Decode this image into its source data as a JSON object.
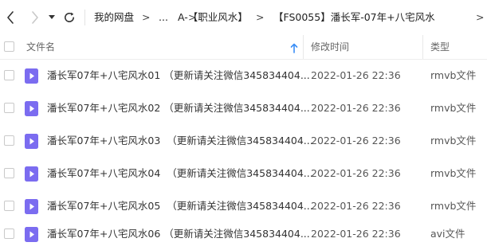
{
  "nav": {
    "back_icon": "chevron-left-icon",
    "forward_icon": "chevron-right-icon",
    "history_icon": "caret-down-icon",
    "refresh_icon": "refresh-icon",
    "breadcrumbs": [
      "我的网盘",
      "...",
      "A-【职业风水】",
      "【FS0055】潘长军-07年+八宅风水"
    ],
    "separator": ">"
  },
  "table": {
    "headers": {
      "name": "文件名",
      "modified": "修改时间",
      "type": "类型"
    },
    "sort_icon": "arrow-up-icon",
    "file_icon": "video-file-icon",
    "accent_color": "#7b6cf0",
    "rows": [
      {
        "name": "潘长军07年+八宅风水01 （更新请关注微信345834404...",
        "modified": "2022-01-26 22:36",
        "type": "rmvb文件"
      },
      {
        "name": "潘长军07年+八宅风水02 （更新请关注微信345834404...",
        "modified": "2022-01-26 22:36",
        "type": "rmvb文件"
      },
      {
        "name": "潘长军07年+八宅风水03  （更新请关注微信345834404...",
        "modified": "2022-01-26 22:36",
        "type": "rmvb文件"
      },
      {
        "name": "潘长军07年+八宅风水04  （更新请关注微信345834404...",
        "modified": "2022-01-26 22:36",
        "type": "rmvb文件"
      },
      {
        "name": "潘长军07年+八宅风水05  （更新请关注微信345834404...",
        "modified": "2022-01-26 22:36",
        "type": "rmvb文件"
      },
      {
        "name": "潘长军07年+八宅风水06 （更新请关注微信345834404...",
        "modified": "2022-01-26 22:36",
        "type": "avi文件"
      }
    ]
  }
}
